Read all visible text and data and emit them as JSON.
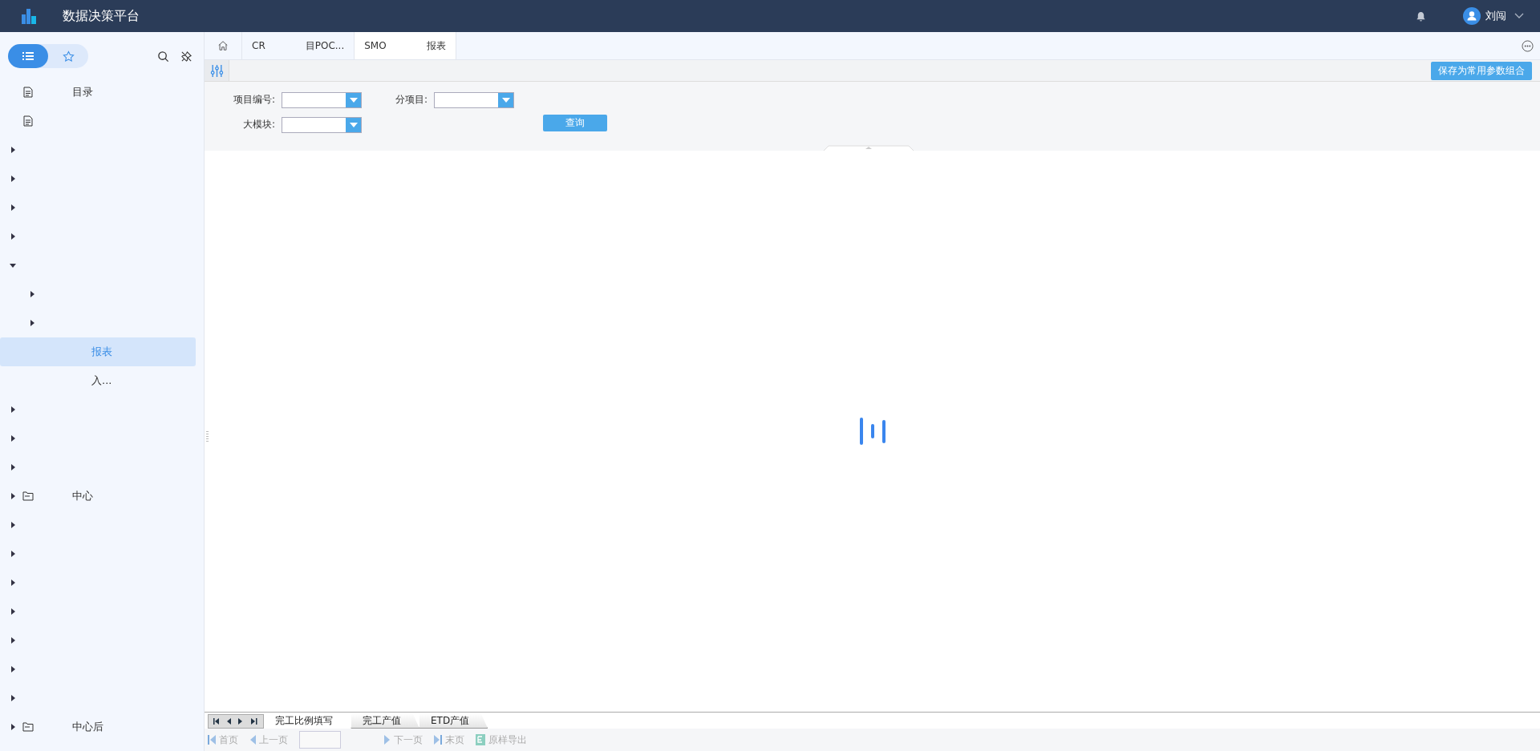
{
  "header": {
    "title": "数据决策平台",
    "user": "刘闯"
  },
  "sidebar": {
    "modes": [
      {
        "selected": true
      },
      {
        "selected": false
      }
    ],
    "items": [
      {
        "kind": "report",
        "label": "目录",
        "selected": false
      },
      {
        "kind": "report",
        "selected": false
      },
      {
        "kind": "folder",
        "expanded": false,
        "selected": false
      },
      {
        "kind": "folder",
        "expanded": false,
        "selected": false
      },
      {
        "kind": "folder",
        "expanded": false,
        "selected": false
      },
      {
        "kind": "folder",
        "expanded": false,
        "selected": false
      },
      {
        "kind": "folder",
        "expanded": true,
        "selected": false,
        "children": [
          {
            "kind": "folder",
            "expanded": false,
            "selected": false
          },
          {
            "kind": "folder",
            "expanded": false,
            "selected": false
          },
          {
            "kind": "report",
            "label": "报表",
            "selected": true
          },
          {
            "kind": "report",
            "label": "入...",
            "selected": false
          }
        ]
      },
      {
        "kind": "folder",
        "expanded": false,
        "selected": false
      },
      {
        "kind": "folder",
        "expanded": false,
        "selected": false
      },
      {
        "kind": "folder",
        "expanded": false,
        "selected": false
      },
      {
        "kind": "folder",
        "expanded": false,
        "selected": false,
        "label": "中心"
      },
      {
        "kind": "folder",
        "expanded": false,
        "selected": false
      },
      {
        "kind": "folder",
        "expanded": false,
        "selected": false
      },
      {
        "kind": "folder",
        "expanded": false,
        "selected": false
      },
      {
        "kind": "folder",
        "expanded": false,
        "selected": false
      },
      {
        "kind": "folder",
        "expanded": false,
        "selected": false
      },
      {
        "kind": "folder",
        "expanded": false,
        "selected": false
      },
      {
        "kind": "folder",
        "expanded": false,
        "selected": false
      },
      {
        "kind": "folder",
        "expanded": false,
        "selected": false,
        "label": "中心后"
      }
    ]
  },
  "tabs": [
    {
      "label": "CR",
      "label_end": "目POC...",
      "selected": false
    },
    {
      "label": "SMO",
      "label_end": "报表",
      "selected": true
    }
  ],
  "params": {
    "save_button": "保存为常用参数组合",
    "fields": [
      {
        "label": "项目编号:"
      },
      {
        "label": "分项目:"
      },
      {
        "label": "大模块:"
      }
    ],
    "query_button": "查询"
  },
  "sheets": [
    {
      "label": "完工比例填写",
      "selected": true
    },
    {
      "label": "完工产值",
      "selected": false
    },
    {
      "label": "ETD产值",
      "selected": false
    }
  ],
  "pager": [
    {
      "kind": "first",
      "label": "首页"
    },
    {
      "kind": "prev",
      "label": "上一页"
    },
    {
      "kind": "input"
    },
    {
      "kind": "next",
      "label": "下一页"
    },
    {
      "kind": "last",
      "label": "末页"
    },
    {
      "kind": "export",
      "label": "原样导出"
    }
  ]
}
